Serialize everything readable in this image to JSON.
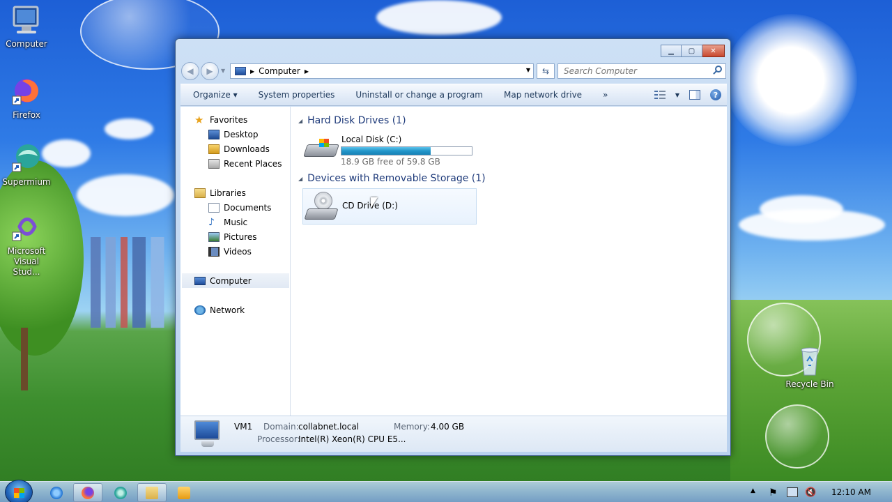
{
  "desktop": {
    "icons": [
      {
        "label": "Computer"
      },
      {
        "label": "Firefox"
      },
      {
        "label": "Supermium"
      },
      {
        "label": "Microsoft Visual Stud..."
      },
      {
        "label": "Recycle Bin"
      }
    ]
  },
  "window": {
    "address": {
      "location": "Computer"
    },
    "search": {
      "placeholder": "Search Computer"
    },
    "toolbar": {
      "organize": "Organize ▾",
      "system_properties": "System properties",
      "uninstall": "Uninstall or change a program",
      "map_drive": "Map network drive",
      "more": "»"
    },
    "nav": {
      "favorites": "Favorites",
      "desktop": "Desktop",
      "downloads": "Downloads",
      "recent": "Recent Places",
      "libraries": "Libraries",
      "documents": "Documents",
      "music": "Music",
      "pictures": "Pictures",
      "videos": "Videos",
      "computer": "Computer",
      "network": "Network"
    },
    "groups": {
      "hdd": {
        "title": "Hard Disk Drives (1)",
        "drive": {
          "name": "Local Disk (C:)",
          "free_text": "18.9 GB free of 59.8 GB",
          "used_fraction": 0.684
        }
      },
      "removable": {
        "title": "Devices with Removable Storage (1)",
        "drive": {
          "name": "CD Drive (D:)"
        }
      }
    },
    "details": {
      "name": "VM1",
      "domain_label": "Domain:",
      "domain": "collabnet.local",
      "memory_label": "Memory:",
      "memory": "4.00 GB",
      "processor_label": "Processor:",
      "processor": "Intel(R) Xeon(R) CPU E5..."
    }
  },
  "taskbar": {
    "clock": "12:10 AM"
  }
}
